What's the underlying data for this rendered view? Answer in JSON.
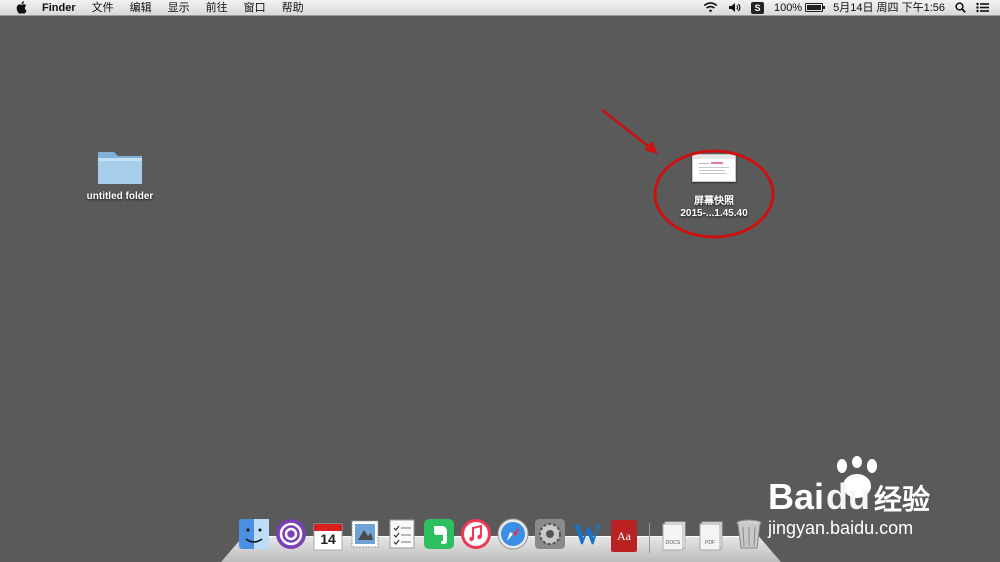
{
  "menubar": {
    "app_name": "Finder",
    "menus": [
      "文件",
      "编辑",
      "显示",
      "前往",
      "窗口",
      "帮助"
    ],
    "status": {
      "battery_percent": "100%",
      "date": "5月14日",
      "weekday": "周四",
      "time": "下午1:56",
      "app_badge": "S"
    }
  },
  "desktop": {
    "folder_label": "untitled folder",
    "file_label_line1": "屏幕快照",
    "file_label_line2": "2015-...1.45.40"
  },
  "dock": {
    "calendar_day": "14",
    "docs_label": "DOCS",
    "pdf_label": "PDF",
    "dictionary_label": "Aa",
    "word_label": "W"
  },
  "watermark": {
    "brand_bai": "Bai",
    "brand_du": "du",
    "brand_cn": "经验",
    "url": "jingyan.baidu.com"
  },
  "colors": {
    "desktop": "#5a5a5a",
    "annotation_red": "#cc1111"
  }
}
